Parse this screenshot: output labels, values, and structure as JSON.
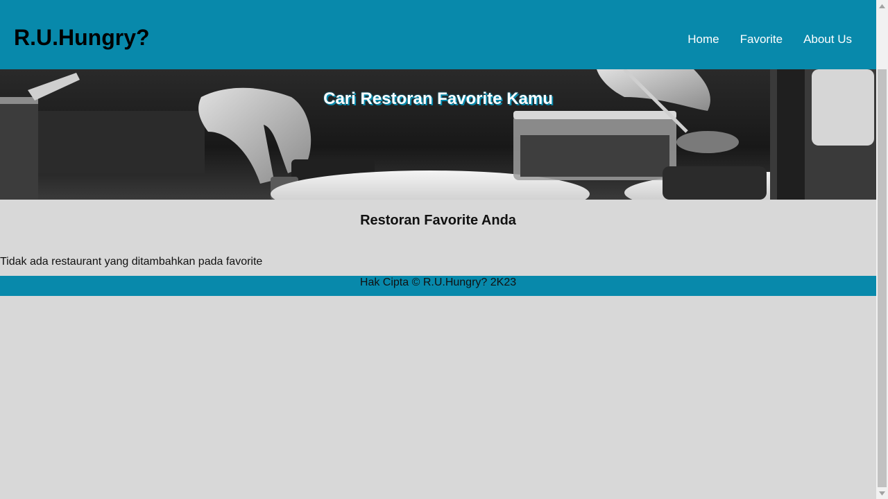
{
  "header": {
    "brand": "R.U.Hungry?",
    "nav": [
      {
        "label": "Home"
      },
      {
        "label": "Favorite"
      },
      {
        "label": "About Us"
      }
    ]
  },
  "hero": {
    "title": "Cari Restoran Favorite Kamu"
  },
  "main": {
    "title": "Restoran Favorite Anda",
    "empty_message": "Tidak ada restaurant yang ditambahkan pada favorite"
  },
  "footer": {
    "text": "Hak Cipta © R.U.Hungry? 2K23"
  },
  "colors": {
    "primary": "#0889ab",
    "background": "#d8d8d8",
    "nav_text": "#ffffff"
  },
  "icons": {
    "scroll_up": "triangle-up-icon",
    "scroll_down": "triangle-down-icon"
  }
}
